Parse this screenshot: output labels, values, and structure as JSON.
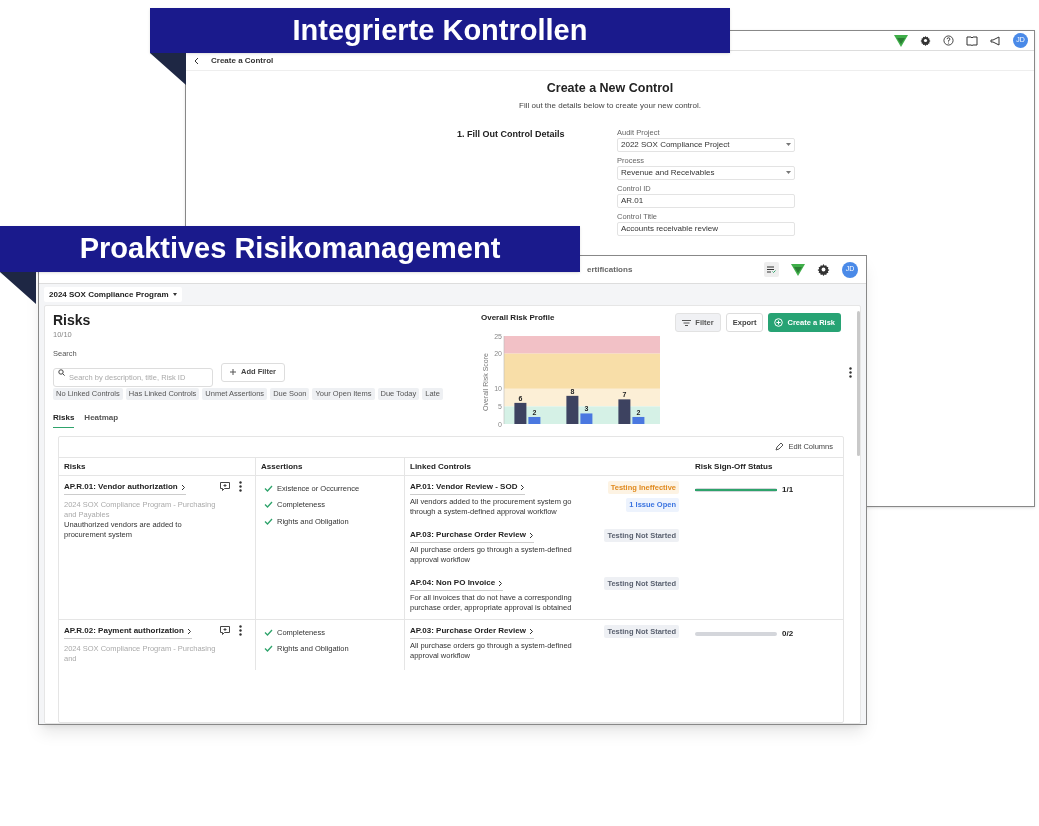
{
  "banners": [
    {
      "text": "Integrierte Kontrollen"
    },
    {
      "text": "Proaktives Risikomanagement"
    }
  ],
  "control_window": {
    "avatar": "JD",
    "back_label": "Create a Control",
    "title": "Create a New Control",
    "subtitle": "Fill out the details below to create your new control.",
    "section": "1. Fill Out Control Details",
    "fields": [
      {
        "label": "Audit Project",
        "value": "2022 SOX Compliance Project",
        "kind": "select"
      },
      {
        "label": "Process",
        "value": "Revenue and Receivables",
        "kind": "select"
      },
      {
        "label": "Control ID",
        "value": "AR.01",
        "kind": "text"
      },
      {
        "label": "Control Title",
        "value": "Accounts receivable review",
        "kind": "text"
      }
    ]
  },
  "risk_window": {
    "nav_item": "ertifications",
    "avatar": "JD",
    "program": "2024 SOX Compliance Program",
    "title": "Risks",
    "count": "10/10",
    "search_label": "Search",
    "search_placeholder": "Search by description, title, Risk ID",
    "add_filter": "Add Filter",
    "buttons": {
      "filter": "Filter",
      "export": "Export",
      "create": "Create a Risk"
    },
    "chips": [
      "No Linked Controls",
      "Has Linked Controls",
      "Unmet Assertions",
      "Due Soon",
      "Your Open Items",
      "Due Today",
      "Late"
    ],
    "tabs": [
      {
        "label": "Risks",
        "selected": true
      },
      {
        "label": "Heatmap",
        "selected": false
      }
    ],
    "chart": {
      "chart_data": {
        "type": "bar",
        "title": "Overall Risk Profile",
        "ylabel": "Overall Risk Score",
        "ylim": [
          0,
          25
        ],
        "yticks": [
          0,
          5,
          10,
          20,
          25
        ],
        "data_labels": true,
        "bands": [
          {
            "axis": "y",
            "from": 20,
            "to": 25,
            "color": "#f2c1c6"
          },
          {
            "axis": "y",
            "from": 10,
            "to": 20,
            "color": "#f8dea8"
          },
          {
            "axis": "y",
            "from": 5,
            "to": 10,
            "color": "#fcefd6"
          },
          {
            "axis": "y",
            "from": 0,
            "to": 5,
            "color": "#d5f1e6"
          }
        ],
        "series": [
          {
            "color": "#3d4260",
            "values": [
              6,
              8,
              7
            ]
          },
          {
            "color": "#4a78e0",
            "values": [
              2,
              3,
              2
            ]
          }
        ]
      }
    },
    "edit_columns": "Edit Columns",
    "columns": [
      "Risks",
      "Assertions",
      "Linked Controls",
      "Risk Sign-Off Status"
    ],
    "rows": [
      {
        "title": "AP.R.01: Vendor authorization",
        "program": "2024 SOX Compliance Program - Purchasing and Payables",
        "description": "Unauthorized vendors are added to procurement system",
        "assertions": [
          "Existence or Occurrence",
          "Completeness",
          "Rights and Obligation"
        ],
        "controls": [
          {
            "title": "AP.01: Vendor Review - SOD",
            "description": "All vendors added to the procurement system go through a system-defined approval workflow",
            "status": "Testing Ineffective",
            "kind": "ineffective",
            "issue": "1 Issue Open"
          },
          {
            "title": "AP.03: Purchase Order Review",
            "description": "All purchase orders go through a system-defined approval workflow",
            "status": "Testing Not Started",
            "kind": "not_started"
          },
          {
            "title": "AP.04: Non PO Invoice",
            "description": "For all invoices that do not have a corresponding purchase order, appropriate approval is obtained",
            "status": "Testing Not Started",
            "kind": "not_started"
          }
        ],
        "signoff": {
          "level": 1,
          "reading": "1/1"
        }
      },
      {
        "title": "AP.R.02: Payment authorization",
        "program": "2024 SOX Compliance Program - Purchasing and",
        "assertions": [
          "Completeness",
          "Rights and Obligation"
        ],
        "controls": [
          {
            "title": "AP.03: Purchase Order Review",
            "description": "All purchase orders go through a system-defined approval workflow",
            "status": "Testing Not Started",
            "kind": "not_started"
          }
        ],
        "signoff": {
          "level": 0,
          "reading": "0/2"
        }
      }
    ]
  }
}
